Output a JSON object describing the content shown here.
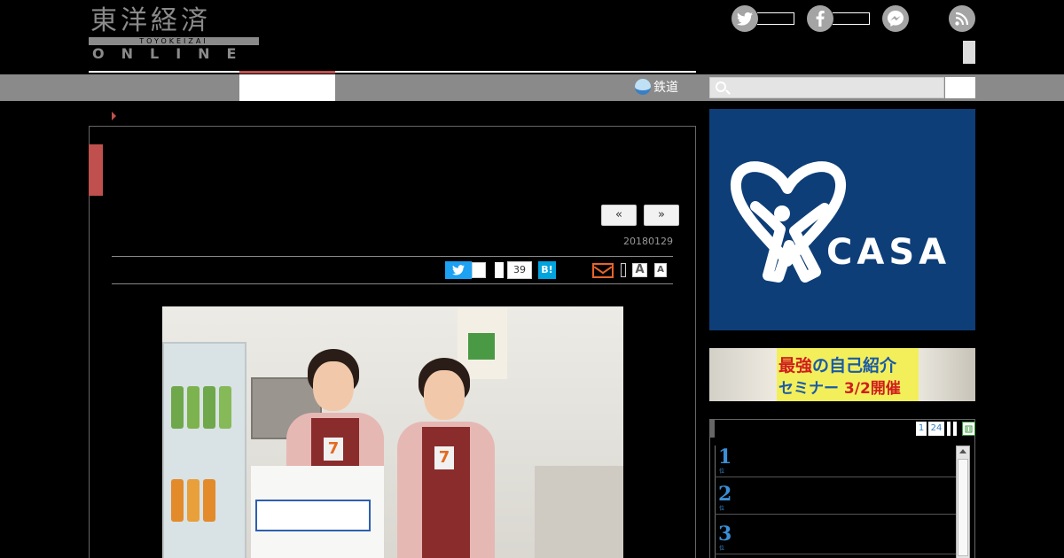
{
  "header": {
    "logo_kanji": "東洋経済",
    "logo_romaji": "TOYOKEIZAI",
    "logo_online": "ONLINE",
    "social_icons": [
      "twitter-icon",
      "facebook-icon",
      "messenger-icon",
      "rss-icon"
    ]
  },
  "nav": {
    "rail_label": "鉄道"
  },
  "article": {
    "prev_label": "«",
    "next_label": "»",
    "date": "20180129",
    "share_count": "39",
    "hatena_label": "B!",
    "font_large": "A",
    "font_small": "A",
    "photo_store_logo_1": "7",
    "photo_store_logo_2": "7"
  },
  "sidebar": {
    "ad_casa": {
      "brand": "CASA",
      "registered": "®"
    },
    "ad_seminar": {
      "line1_a": "最強",
      "line1_b": "の自己紹介",
      "line2_a": "セミナー",
      "line2_b": "3/2開催"
    },
    "ranking": {
      "tabs": [
        "1",
        "24"
      ],
      "items": [
        {
          "num": "1",
          "sub": "位"
        },
        {
          "num": "2",
          "sub": "位"
        },
        {
          "num": "3",
          "sub": "位"
        }
      ]
    }
  },
  "colors": {
    "accent_red": "#c0504d",
    "twitter_blue": "#1da1f2",
    "hatena_blue": "#00a4de",
    "casa_navy": "#0e3e78",
    "rank_blue": "#3a8fd6"
  }
}
